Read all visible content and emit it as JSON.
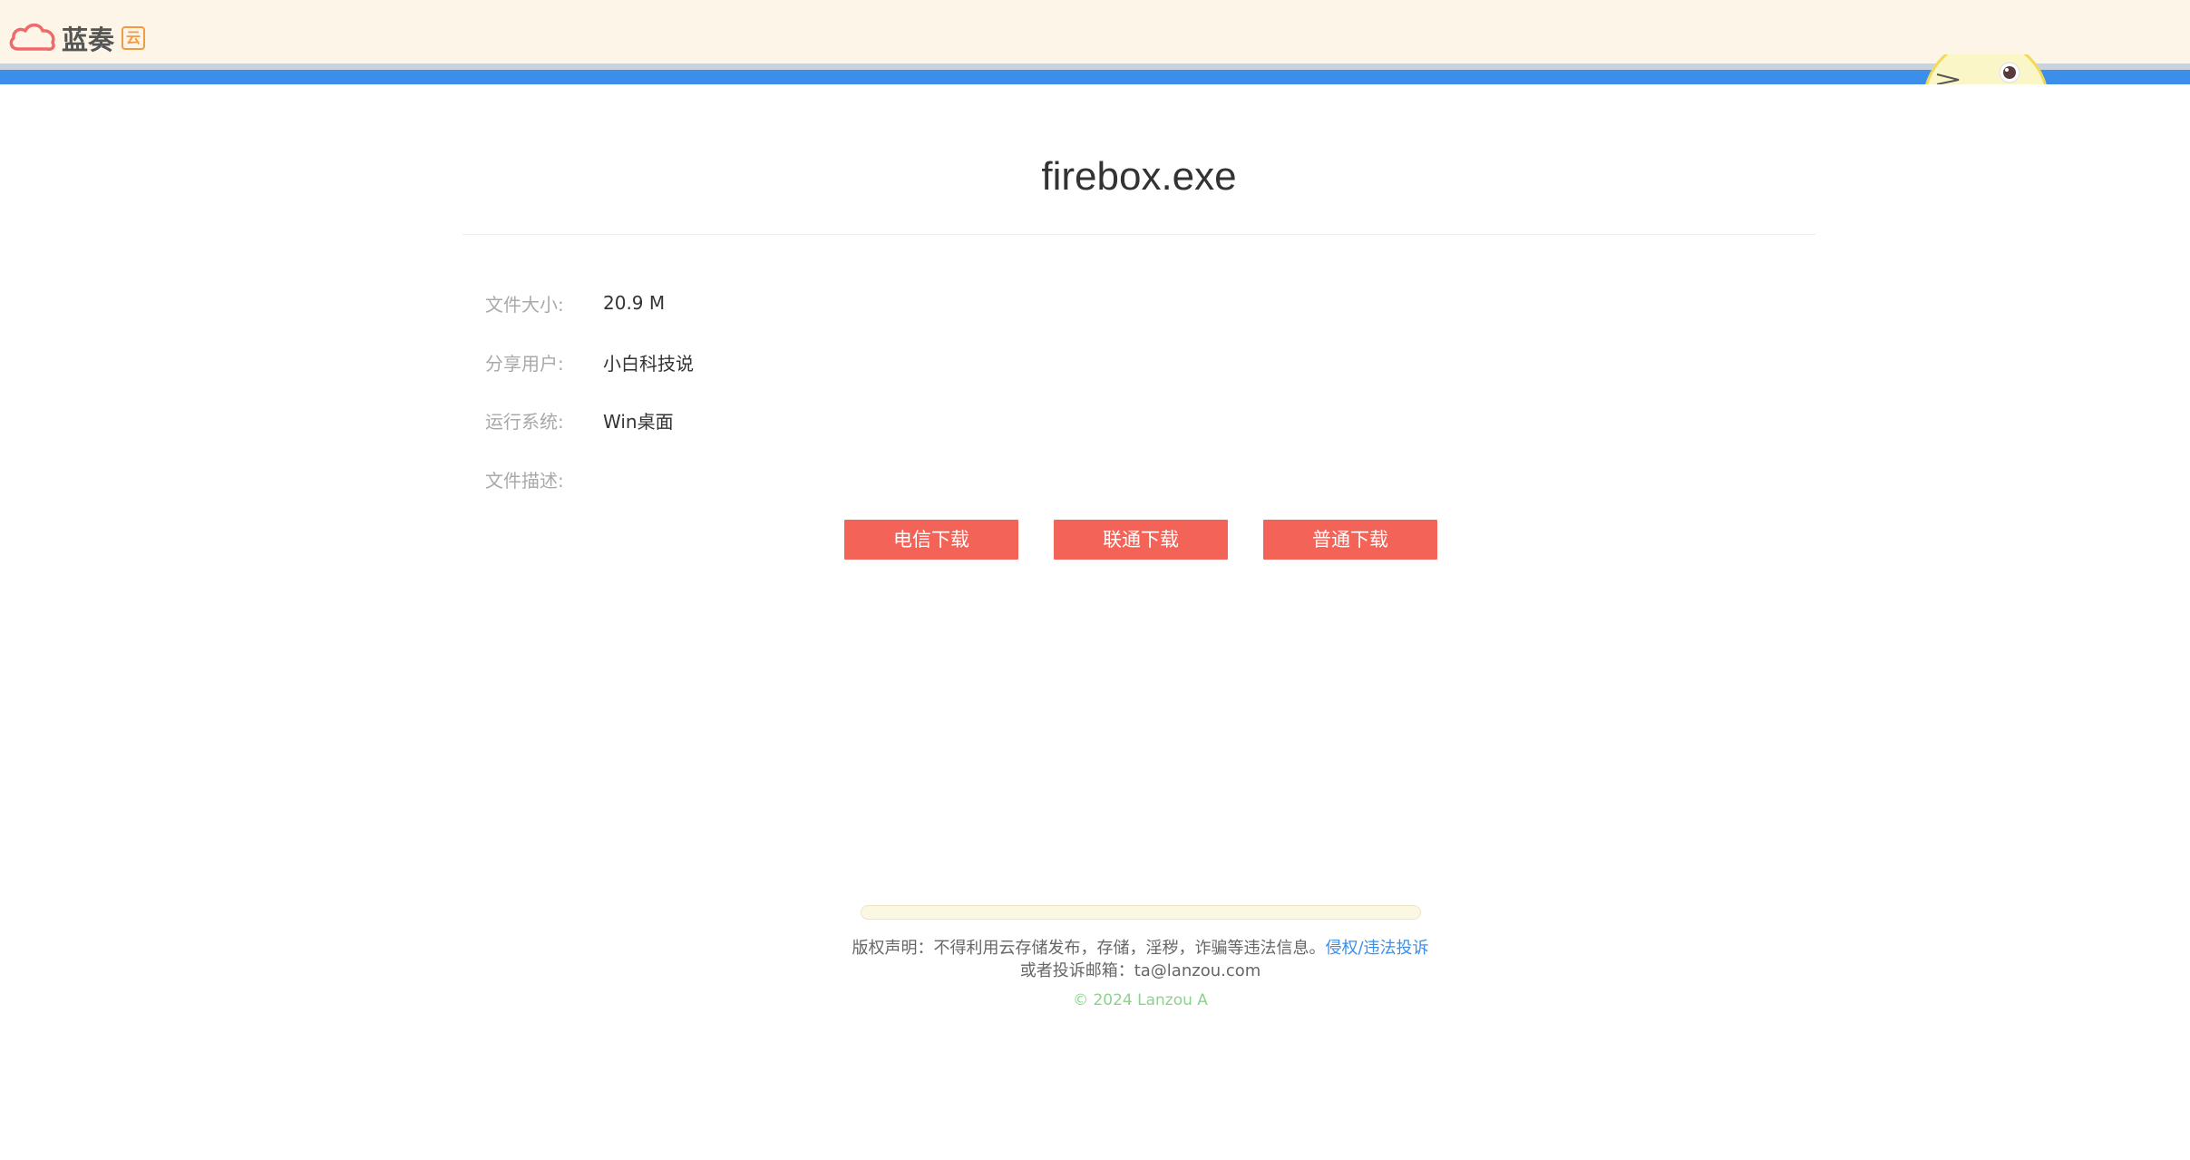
{
  "header": {
    "logo_text": "蓝奏",
    "logo_badge": "云"
  },
  "file": {
    "name": "firebox.exe",
    "fields": [
      {
        "label": "文件大小:",
        "value": "20.9 M"
      },
      {
        "label": "分享用户:",
        "value": "小白科技说"
      },
      {
        "label": "运行系统:",
        "value": "Win桌面"
      },
      {
        "label": "文件描述:",
        "value": ""
      }
    ]
  },
  "downloads": {
    "telecom_label": "电信下载",
    "unicom_label": "联通下载",
    "normal_label": "普通下载"
  },
  "footer": {
    "notice": "版权声明：不得利用云存储发布，存储，淫秽，诈骗等违法信息。",
    "report_link": "侵权/违法投诉",
    "email_line": "或者投诉邮箱：ta@lanzou.com",
    "copyright": "© 2024 Lanzou A"
  },
  "colors": {
    "accent_blue": "#3b8eea",
    "button_red": "#f46357",
    "topbar_bg": "#fdf5e8",
    "copyright_green": "#8fd18f"
  }
}
